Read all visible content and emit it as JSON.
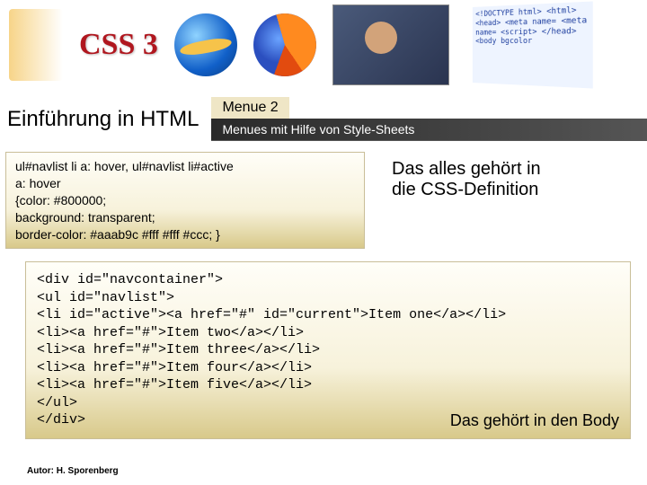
{
  "banner": {
    "css3_label": "CSS 3",
    "code_sample": "<!DOCTYPE html>\n<html>\n <head>\n  <meta name=\n  <meta name=\n  <script>\n </head>\n <body bgcolor"
  },
  "title": {
    "left": "Einführung in HTML",
    "top": "Menue 2",
    "bottom": "Menues mit Hilfe von Style-Sheets"
  },
  "css_card": {
    "l1": "ul#navlist li a: hover, ul#navlist li#active",
    "l2": "a: hover",
    "l3": "{color: #800000;",
    "l4": "background: transparent;",
    "l5": "border-color: #aaab9c #fff #fff #ccc; }"
  },
  "side_note": {
    "l1": "Das alles gehört in",
    "l2": "die CSS-Definition"
  },
  "html_card": {
    "l1": "<div id=\"navcontainer\">",
    "l2": "<ul id=\"navlist\">",
    "l3": "<li id=\"active\"><a href=\"#\" id=\"current\">Item one</a></li>",
    "l4": "<li><a href=\"#\">Item two</a></li>",
    "l5": "<li><a href=\"#\">Item three</a></li>",
    "l6": "<li><a href=\"#\">Item four</a></li>",
    "l7": "<li><a href=\"#\">Item five</a></li>",
    "l8": "</ul>",
    "l9": "</div>"
  },
  "body_note": "Das gehört in den Body",
  "footer": "Autor: H. Sporenberg"
}
